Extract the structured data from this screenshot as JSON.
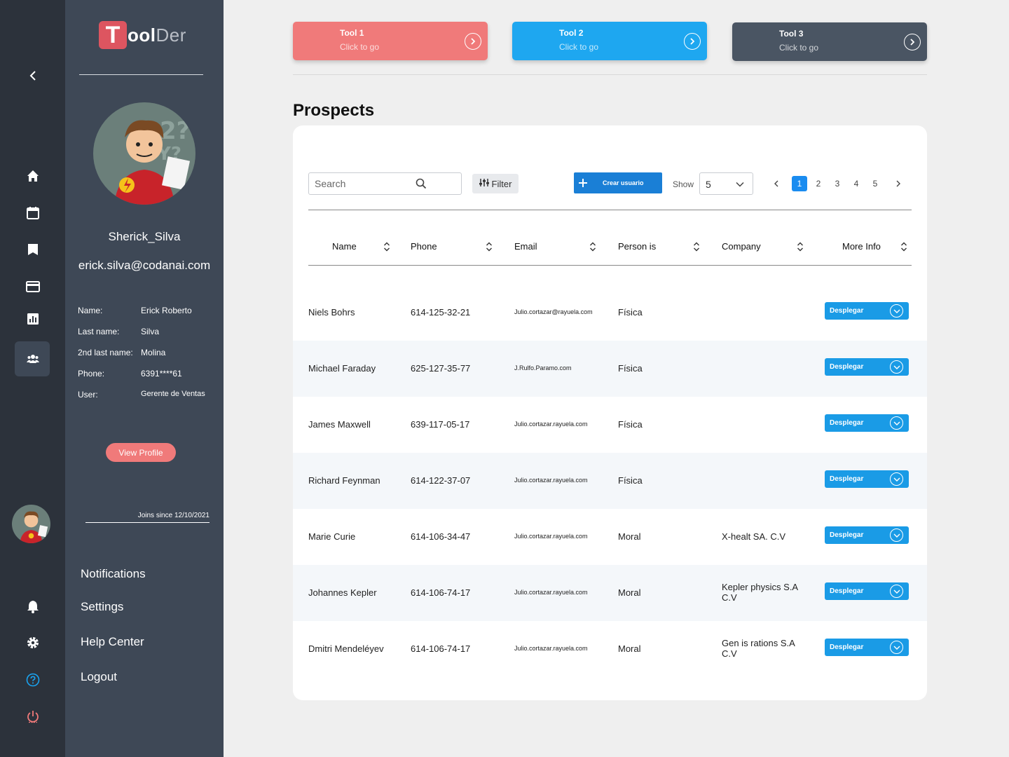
{
  "brand": {
    "logo_letter": "T",
    "logo_bold": "ool",
    "logo_rest": "Der"
  },
  "colors": {
    "accent_red": "#dd5560",
    "accent_blue": "#1a9be6",
    "rail": "#2c323b",
    "panel": "#3e4856",
    "tool1": "#f07a7a",
    "tool2": "#1ea7f0",
    "tool3": "#4a5563"
  },
  "rail": {
    "icons": [
      "chevron-left-icon",
      "home-icon",
      "calendar-icon",
      "bookmark-icon",
      "card-icon",
      "chart-icon",
      "users-icon",
      "bell-icon",
      "gear-icon",
      "help-icon",
      "power-icon"
    ]
  },
  "profile": {
    "username": "Sherick_Silva",
    "email": "erick.silva@codanai.com",
    "fields": [
      {
        "label": "Name:",
        "value": "Erick Roberto"
      },
      {
        "label": "Last name:",
        "value": "Silva"
      },
      {
        "label": "2nd last name:",
        "value": "Molina"
      },
      {
        "label": "Phone:",
        "value": "6391****61"
      },
      {
        "label": "User:",
        "value": "Gerente de Ventas"
      }
    ],
    "view_profile": "View Profile",
    "joins": "Joins since 12/10/2021"
  },
  "menu": [
    "Notifications",
    "Settings",
    "Help Center",
    "Logout"
  ],
  "tools": [
    {
      "title": "Tool 1",
      "subtitle": "Click to go"
    },
    {
      "title": "Tool 2",
      "subtitle": "Click to go"
    },
    {
      "title": "Tool 3",
      "subtitle": "Click to go"
    }
  ],
  "page_title": "Prospects",
  "toolbar": {
    "search_placeholder": "Search",
    "filter_label": "Filter",
    "create_label": "Crear usuario",
    "show_label": "Show",
    "show_value": "5",
    "pages": [
      "1",
      "2",
      "3",
      "4",
      "5"
    ],
    "current_page": "1"
  },
  "table": {
    "columns": [
      "Name",
      "Phone",
      "Email",
      "Person is",
      "Company",
      "More Info"
    ],
    "rows": [
      {
        "name": "Niels Bohrs",
        "phone": "614-125-32-21",
        "email": "Julio.cortazar@rayuela.com",
        "person": "Física",
        "company": "",
        "action": "Desplegar"
      },
      {
        "name": "Michael Faraday",
        "phone": "625-127-35-77",
        "email": "J.Rulfo.Paramo.com",
        "person": "Física",
        "company": "",
        "action": "Desplegar"
      },
      {
        "name": "James Maxwell",
        "phone": "639-117-05-17",
        "email": "Julio.cortazar.rayuela.com",
        "person": "Física",
        "company": "",
        "action": "Desplegar"
      },
      {
        "name": "Richard Feynman",
        "phone": "614-122-37-07",
        "email": "Julio.cortazar.rayuela.com",
        "person": "Física",
        "company": "",
        "action": "Desplegar"
      },
      {
        "name": "Marie Curie",
        "phone": "614-106-34-47",
        "email": "Julio.cortazar.rayuela.com",
        "person": "Moral",
        "company": "X-healt SA. C.V",
        "action": "Desplegar"
      },
      {
        "name": "Johannes Kepler",
        "phone": "614-106-74-17",
        "email": "Julio.cortazar.rayuela.com",
        "person": "Moral",
        "company": "Kepler physics S.A C.V",
        "action": "Desplegar"
      },
      {
        "name": "Dmitri Mendeléyev",
        "phone": "614-106-74-17",
        "email": "Julio.cortazar.rayuela.com",
        "person": "Moral",
        "company": "Gen is rations S.A C.V",
        "action": "Desplegar"
      }
    ]
  }
}
